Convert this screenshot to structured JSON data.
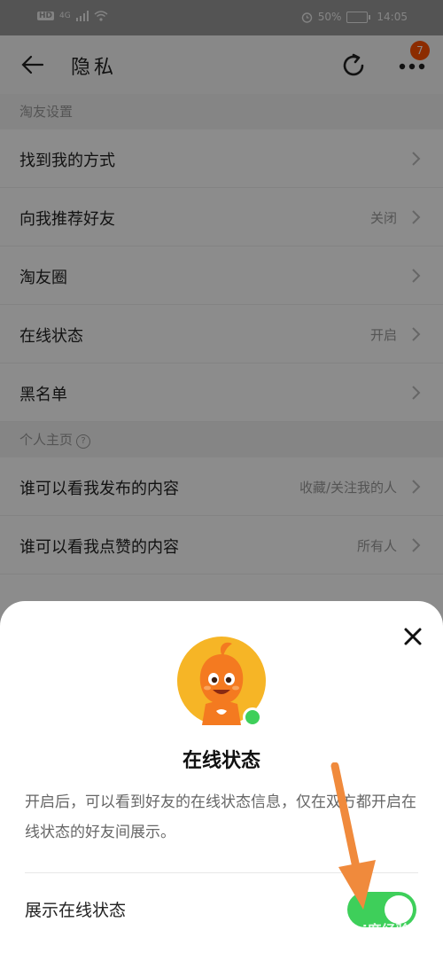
{
  "status_bar": {
    "hd": "HD",
    "network": "4G",
    "battery_percent": "50%",
    "time": "14:05"
  },
  "nav": {
    "title": "隐私",
    "more_badge": "7"
  },
  "sections": [
    {
      "header": "淘友设置",
      "rows": [
        {
          "label": "找到我的方式",
          "value": ""
        },
        {
          "label": "向我推荐好友",
          "value": "关闭"
        },
        {
          "label": "淘友圈",
          "value": ""
        },
        {
          "label": "在线状态",
          "value": "开启"
        },
        {
          "label": "黑名单",
          "value": ""
        }
      ]
    },
    {
      "header": "个人主页",
      "rows": [
        {
          "label": "谁可以看我发布的内容",
          "value": "收藏/关注我的人"
        },
        {
          "label": "谁可以看我点赞的内容",
          "value": "所有人"
        }
      ]
    }
  ],
  "sheet": {
    "title": "在线状态",
    "description": "开启后，可以看到好友的在线状态信息，仅在双方都开启在线状态的好友间展示。",
    "toggle_label": "展示在线状态",
    "toggle_on": true
  },
  "watermark": "Bai度经验",
  "colors": {
    "accent": "#ff5000",
    "toggle_on": "#3ecf5a",
    "arrow": "#f08a3c"
  }
}
